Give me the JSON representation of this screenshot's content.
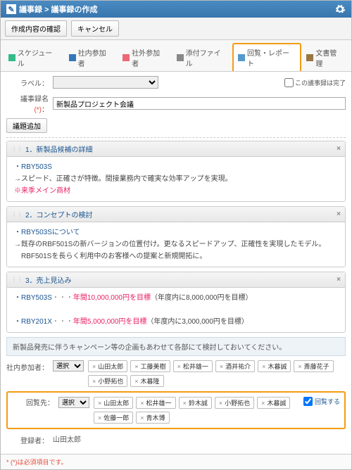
{
  "header": {
    "breadcrumb": "議事録 > 議事録の作成"
  },
  "buttons": {
    "confirm": "作成内容の確認",
    "cancel": "キャンセル",
    "addTopic": "議題追加",
    "select": "選択"
  },
  "tabs": [
    {
      "label": "スケジュール"
    },
    {
      "label": "社内参加者"
    },
    {
      "label": "社外参加者"
    },
    {
      "label": "添付ファイル"
    },
    {
      "label": "回覧・レポート"
    },
    {
      "label": "文書管理"
    }
  ],
  "form": {
    "labelLabel": "ラベル：",
    "completeLabel": "この議事録は完了",
    "nameLabel": "議事録名",
    "nameValue": "新製品プロジェクト会議"
  },
  "topics": [
    {
      "num": "1．",
      "title": "新製品候補の詳細",
      "body": [
        {
          "t": "・",
          "c": "blue"
        },
        {
          "t": "RBY503S",
          "c": "blue",
          "br": true
        },
        {
          "t": "→スピード、正確さが特徴。間接業務内で確実な効率アップを実現。",
          "br": true
        },
        {
          "t": "※来季メイン商材",
          "c": "pink",
          "br": true
        }
      ]
    },
    {
      "num": "2．",
      "title": "コンセプトの検討",
      "body": [
        {
          "t": "・",
          "c": "blue"
        },
        {
          "t": "RBY503Sについて",
          "c": "blue",
          "br": true
        },
        {
          "t": "→既存のRBF501Sの新バージョンの位置付け。更なるスピードアップ、正確性を実現したモデル。",
          "br": true
        },
        {
          "t": "　RBF501Sを長らく利用中のお客様への提案と新規開拓に。",
          "br": true
        }
      ]
    },
    {
      "num": "3．",
      "title": "売上見込み",
      "body": [
        {
          "t": "・",
          "c": "blue"
        },
        {
          "t": "RBY503S",
          "c": "blue"
        },
        {
          "t": "・・・",
          "c": "dots"
        },
        {
          "t": "年間10,000,000円を目標",
          "c": "pink"
        },
        {
          "t": "（年度内に8,000,000円を目標）",
          "br": true
        },
        {
          "t": " ",
          "br": true
        },
        {
          "t": "・",
          "c": "blue"
        },
        {
          "t": "RBY201X",
          "c": "blue"
        },
        {
          "t": "・・・",
          "c": "dots"
        },
        {
          "t": "年間5,000,000円を目標",
          "c": "pink"
        },
        {
          "t": "（年度内に3,000,000円を目標）",
          "br": true
        }
      ]
    }
  ],
  "note": "新製品発売に伴うキャンペーン等の企画もあわせて各部にて検討しておいてください。",
  "internal": {
    "label": "社内参加者：",
    "people": [
      "山田太郎",
      "工藤美樹",
      "松井雄一",
      "酒井祐介",
      "木暮誠",
      "斎藤花子",
      "小野拓也",
      "木暮隆"
    ]
  },
  "reply": {
    "label": "回覧先：",
    "people": [
      "山田太郎",
      "松井雄一",
      "鈴木誠",
      "小野拓也",
      "木暮誠",
      "佐藤一郎",
      "青木博"
    ],
    "chkLabel": "回覧する"
  },
  "registrant": {
    "label": "登録者：",
    "value": "山田太郎"
  },
  "footnote": "* (*)は必須項目です。"
}
